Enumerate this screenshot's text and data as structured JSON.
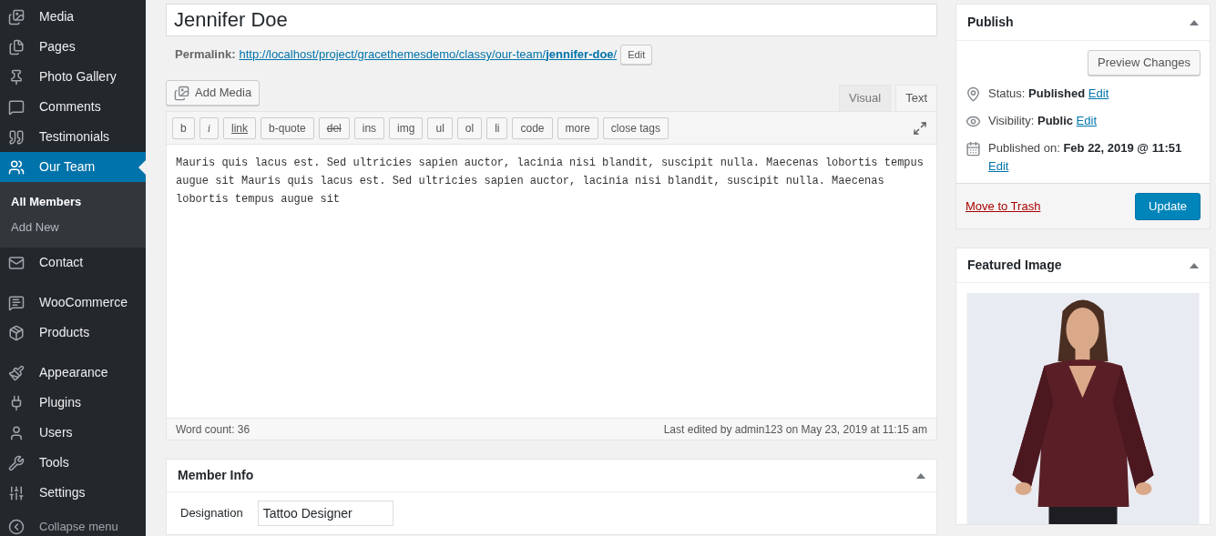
{
  "sidebar": {
    "groups": [
      {
        "items": [
          {
            "label": "Media",
            "selected": false
          },
          {
            "label": "Pages",
            "selected": false
          },
          {
            "label": "Photo Gallery",
            "selected": false
          },
          {
            "label": "Comments",
            "selected": false
          },
          {
            "label": "Testimonials",
            "selected": false
          },
          {
            "label": "Our Team",
            "selected": true,
            "children": [
              {
                "label": "All Members",
                "selected": true
              },
              {
                "label": "Add New",
                "selected": false
              }
            ]
          },
          {
            "label": "Contact",
            "selected": false
          }
        ]
      },
      {
        "items": [
          {
            "label": "WooCommerce",
            "selected": false
          },
          {
            "label": "Products",
            "selected": false
          }
        ]
      },
      {
        "items": [
          {
            "label": "Appearance",
            "selected": false
          },
          {
            "label": "Plugins",
            "selected": false
          },
          {
            "label": "Users",
            "selected": false
          },
          {
            "label": "Tools",
            "selected": false
          },
          {
            "label": "Settings",
            "selected": false
          }
        ]
      }
    ],
    "collapse_label": "Collapse menu"
  },
  "editor": {
    "title": "Jennifer Doe",
    "permalink_label": "Permalink:",
    "permalink_url": "http://localhost/project/gracethemesdemo/classy/our-team/**jennifer-doe**/",
    "permalink_edit": "Edit",
    "add_media": "Add Media",
    "tabs": [
      {
        "label": "Visual",
        "selected": false
      },
      {
        "label": "Text",
        "selected": true
      }
    ],
    "quicktags": [
      {
        "label": "b",
        "kind": "plain"
      },
      {
        "label": "i",
        "kind": "italic"
      },
      {
        "label": "link",
        "kind": "underline"
      },
      {
        "label": "b-quote",
        "kind": "plain"
      },
      {
        "label": "del",
        "kind": "strike"
      },
      {
        "label": "ins",
        "kind": "plain"
      },
      {
        "label": "img",
        "kind": "plain"
      },
      {
        "label": "ul",
        "kind": "plain"
      },
      {
        "label": "ol",
        "kind": "plain"
      },
      {
        "label": "li",
        "kind": "plain"
      },
      {
        "label": "code",
        "kind": "plain"
      },
      {
        "label": "more",
        "kind": "plain"
      },
      {
        "label": "close tags",
        "kind": "plain"
      }
    ],
    "content": "Mauris quis lacus est. Sed ultricies sapien auctor, lacinia nisi blandit, suscipit nulla. Maecenas lobortis tempus augue sit Mauris quis lacus est. Sed ultricies sapien auctor, lacinia nisi blandit, suscipit nulla. Maecenas lobortis tempus augue sit",
    "word_count": "Word count: 36",
    "last_edited": "Last edited by admin123 on May 23, 2019 at 11:15 am"
  },
  "member_info": {
    "title": "Member Info",
    "fields": [
      {
        "label": "Designation",
        "value": "Tattoo Designer"
      }
    ]
  },
  "publish": {
    "title": "Publish",
    "preview": "Preview Changes",
    "rows": [
      {
        "kind": "status",
        "label": "Status:",
        "value": "Published",
        "link": "Edit"
      },
      {
        "kind": "visibility",
        "label": "Visibility:",
        "value": "Public",
        "link": "Edit"
      },
      {
        "kind": "date",
        "label": "Published on:",
        "value": "Feb 22, 2019 @ 11:51",
        "link": "Edit"
      }
    ],
    "trash": "Move to Trash",
    "update": "Update"
  },
  "featured_image": {
    "title": "Featured Image",
    "kind": "picture"
  }
}
